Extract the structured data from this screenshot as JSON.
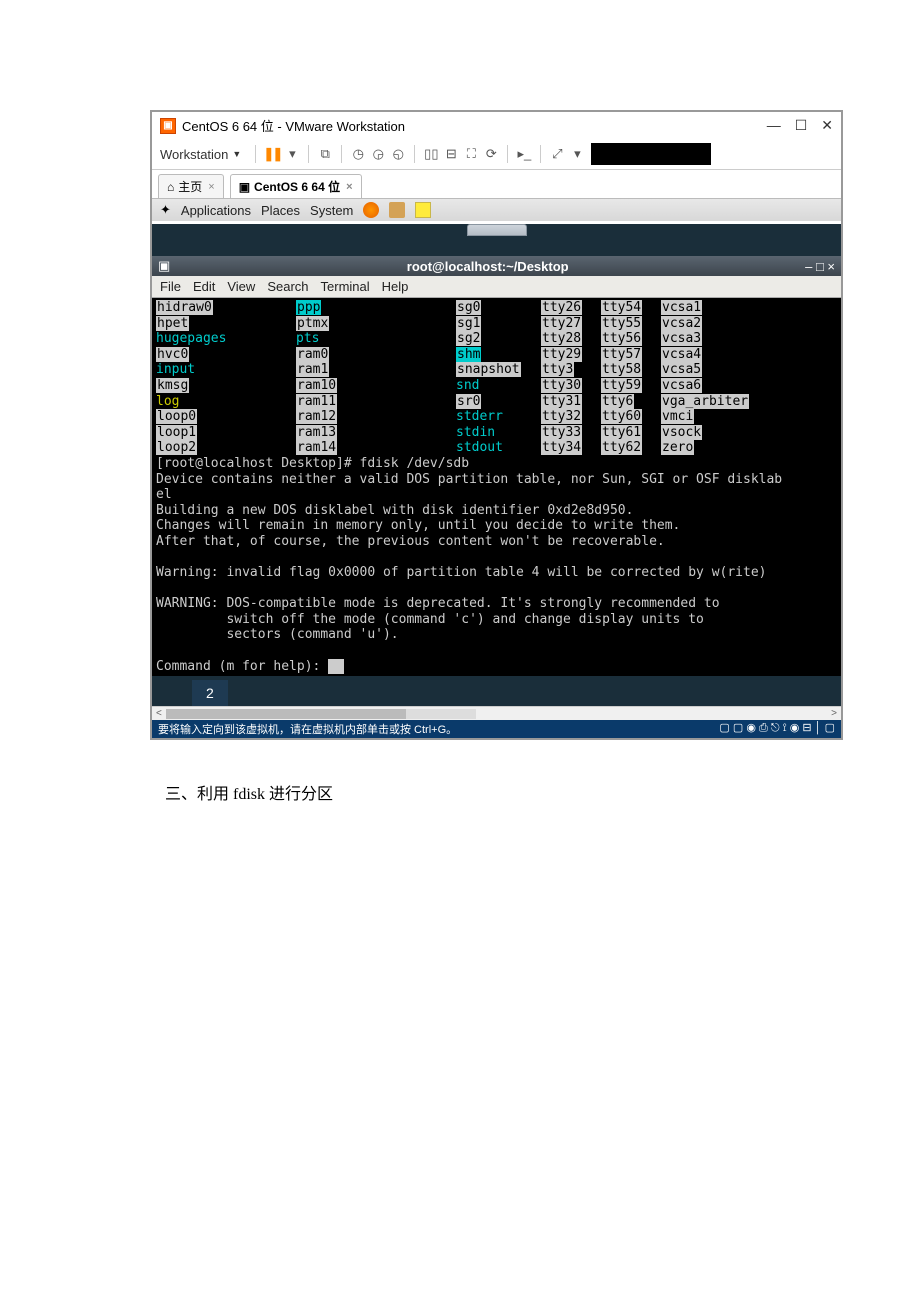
{
  "window": {
    "title": "CentOS 6 64 位 - VMware Workstation",
    "ws_label": "Workstation"
  },
  "tabs": {
    "home": "主页",
    "vm": "CentOS 6 64 位"
  },
  "gnome": {
    "apps": "Applications",
    "places": "Places",
    "system": "System"
  },
  "terminal": {
    "title": "root@localhost:~/Desktop",
    "menu": {
      "file": "File",
      "edit": "Edit",
      "view": "View",
      "search": "Search",
      "terminal": "Terminal",
      "help": "Help"
    },
    "listing": [
      {
        "c0": {
          "t": "hidraw0",
          "s": "hl"
        },
        "c1": {
          "t": "ppp",
          "s": "hl-cyan"
        },
        "c2": {
          "t": "sg0",
          "s": "hl"
        },
        "c3": {
          "t": "tty26",
          "s": "hl"
        },
        "c4": {
          "t": "tty54",
          "s": "hl"
        },
        "c5": {
          "t": "vcsa1",
          "s": "hl"
        }
      },
      {
        "c0": {
          "t": "hpet",
          "s": "hl"
        },
        "c1": {
          "t": "ptmx",
          "s": "hl"
        },
        "c2": {
          "t": "sg1",
          "s": "hl"
        },
        "c3": {
          "t": "tty27",
          "s": "hl"
        },
        "c4": {
          "t": "tty55",
          "s": "hl"
        },
        "c5": {
          "t": "vcsa2",
          "s": "hl"
        }
      },
      {
        "c0": {
          "t": "hugepages",
          "s": "cyan"
        },
        "c1": {
          "t": "pts",
          "s": "cyan"
        },
        "c2": {
          "t": "sg2",
          "s": "hl"
        },
        "c3": {
          "t": "tty28",
          "s": "hl"
        },
        "c4": {
          "t": "tty56",
          "s": "hl"
        },
        "c5": {
          "t": "vcsa3",
          "s": "hl"
        }
      },
      {
        "c0": {
          "t": "hvc0",
          "s": "hl"
        },
        "c1": {
          "t": "ram0",
          "s": "hl"
        },
        "c2": {
          "t": "shm",
          "s": "hl-cyan"
        },
        "c3": {
          "t": "tty29",
          "s": "hl"
        },
        "c4": {
          "t": "tty57",
          "s": "hl"
        },
        "c5": {
          "t": "vcsa4",
          "s": "hl"
        }
      },
      {
        "c0": {
          "t": "input",
          "s": "cyan"
        },
        "c1": {
          "t": "ram1",
          "s": "hl"
        },
        "c2": {
          "t": "snapshot",
          "s": "hl"
        },
        "c3": {
          "t": "tty3",
          "s": "hl"
        },
        "c4": {
          "t": "tty58",
          "s": "hl"
        },
        "c5": {
          "t": "vcsa5",
          "s": "hl"
        }
      },
      {
        "c0": {
          "t": "kmsg",
          "s": "hl"
        },
        "c1": {
          "t": "ram10",
          "s": "hl"
        },
        "c2": {
          "t": "snd",
          "s": "cyan"
        },
        "c3": {
          "t": "tty30",
          "s": "hl"
        },
        "c4": {
          "t": "tty59",
          "s": "hl"
        },
        "c5": {
          "t": "vcsa6",
          "s": "hl"
        }
      },
      {
        "c0": {
          "t": "log",
          "s": "yellow"
        },
        "c1": {
          "t": "ram11",
          "s": "hl"
        },
        "c2": {
          "t": "sr0",
          "s": "hl"
        },
        "c3": {
          "t": "tty31",
          "s": "hl"
        },
        "c4": {
          "t": "tty6",
          "s": "hl"
        },
        "c5": {
          "t": "vga_arbiter",
          "s": "hl"
        }
      },
      {
        "c0": {
          "t": "loop0",
          "s": "hl"
        },
        "c1": {
          "t": "ram12",
          "s": "hl"
        },
        "c2": {
          "t": "stderr",
          "s": "cyan"
        },
        "c3": {
          "t": "tty32",
          "s": "hl"
        },
        "c4": {
          "t": "tty60",
          "s": "hl"
        },
        "c5": {
          "t": "vmci",
          "s": "hl"
        }
      },
      {
        "c0": {
          "t": "loop1",
          "s": "hl"
        },
        "c1": {
          "t": "ram13",
          "s": "hl"
        },
        "c2": {
          "t": "stdin",
          "s": "cyan"
        },
        "c3": {
          "t": "tty33",
          "s": "hl"
        },
        "c4": {
          "t": "tty61",
          "s": "hl"
        },
        "c5": {
          "t": "vsock",
          "s": "hl"
        }
      },
      {
        "c0": {
          "t": "loop2",
          "s": "hl"
        },
        "c1": {
          "t": "ram14",
          "s": "hl"
        },
        "c2": {
          "t": "stdout",
          "s": "cyan"
        },
        "c3": {
          "t": "tty34",
          "s": "hl"
        },
        "c4": {
          "t": "tty62",
          "s": "hl"
        },
        "c5": {
          "t": "zero",
          "s": "hl"
        }
      }
    ],
    "body": "[root@localhost Desktop]# fdisk /dev/sdb\nDevice contains neither a valid DOS partition table, nor Sun, SGI or OSF disklab\nel\nBuilding a new DOS disklabel with disk identifier 0xd2e8d950.\nChanges will remain in memory only, until you decide to write them.\nAfter that, of course, the previous content won't be recoverable.\n\nWarning: invalid flag 0x0000 of partition table 4 will be corrected by w(rite)\n\nWARNING: DOS-compatible mode is deprecated. It's strongly recommended to\n         switch off the mode (command 'c') and change display units to\n         sectors (command 'u').\n\nCommand (m for help): "
  },
  "badge": "2",
  "status_hint": "要将输入定向到该虚拟机，请在虚拟机内部单击或按 Ctrl+G。",
  "doc_text": "三、利用 fdisk 进行分区"
}
